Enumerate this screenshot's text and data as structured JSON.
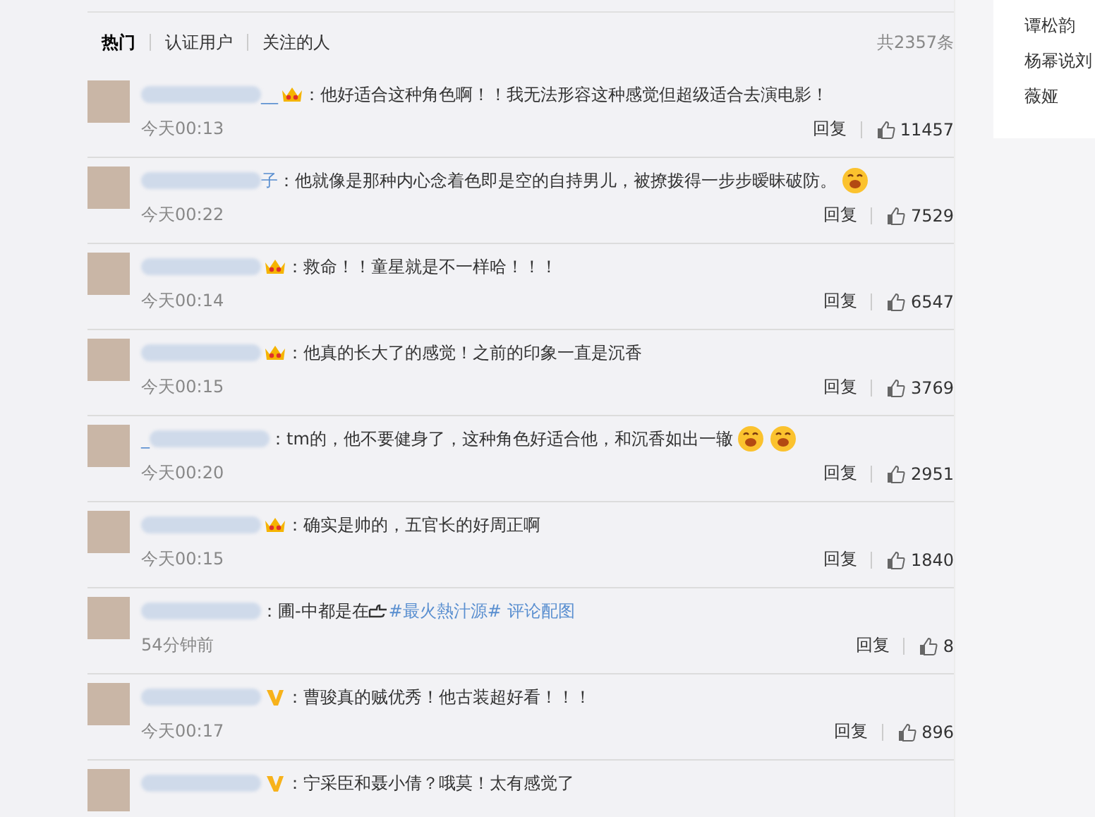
{
  "tabs": [
    {
      "label": "热门",
      "selected": true
    },
    {
      "label": "认证用户",
      "selected": false
    },
    {
      "label": "关注的人",
      "selected": false
    }
  ],
  "total": "共2357条",
  "sidebar": {
    "items": [
      "谭松韵",
      "杨幂说刘",
      "薇娅"
    ]
  },
  "comments": [
    {
      "name_tail": "__",
      "badge": {
        "kind": "crown"
      },
      "content": [
        {
          "kind": "text",
          "text": "：他好适合这种角色啊！！我无法形容这种感觉但超级适合去演电影！"
        }
      ],
      "time": "今天00:13",
      "reply": "回复",
      "likes": "11457"
    },
    {
      "name_tail": "子",
      "content": [
        {
          "kind": "text",
          "text": "：他就像是那种内心念着色即是空的自持男儿，被撩拨得一步步暧昧破防。"
        },
        {
          "kind": "emoji"
        }
      ],
      "time": "今天00:22",
      "reply": "回复",
      "likes": "7529"
    },
    {
      "badge": {
        "kind": "crown"
      },
      "content": [
        {
          "kind": "text",
          "text": "：救命！！童星就是不一样哈！！！"
        }
      ],
      "time": "今天00:14",
      "reply": "回复",
      "likes": "6547"
    },
    {
      "badge": {
        "kind": "crown"
      },
      "content": [
        {
          "kind": "text",
          "text": "：他真的长大了的感觉！之前的印象一直是沉香"
        }
      ],
      "time": "今天00:15",
      "reply": "回复",
      "likes": "3769"
    },
    {
      "name_head": "_",
      "content": [
        {
          "kind": "text",
          "text": "：tm的，他不要健身了，这种角色好适合他，和沉香如出一辙"
        },
        {
          "kind": "emoji"
        },
        {
          "kind": "emoji"
        }
      ],
      "time": "今天00:20",
      "reply": "回复",
      "likes": "2951"
    },
    {
      "badge": {
        "kind": "crown"
      },
      "content": [
        {
          "kind": "text",
          "text": "：确实是帅的，五官长的好周正啊"
        }
      ],
      "time": "今天00:15",
      "reply": "回复",
      "likes": "1840"
    },
    {
      "content": [
        {
          "kind": "text",
          "text": "：圃-中都是在"
        },
        {
          "kind": "hand"
        },
        {
          "kind": "link",
          "text": "#最火熱汁源# 评论配图"
        }
      ],
      "time": "54分钟前",
      "reply": "回复",
      "likes": "8"
    },
    {
      "badge": {
        "kind": "v"
      },
      "content": [
        {
          "kind": "text",
          "text": "：曹骏真的贼优秀！他古装超好看！！！"
        }
      ],
      "time": "今天00:17",
      "reply": "回复",
      "likes": "896"
    },
    {
      "badge": {
        "kind": "v"
      },
      "content": [
        {
          "kind": "text",
          "text": "：宁采臣和聂小倩？哦莫！太有感觉了"
        }
      ]
    }
  ]
}
